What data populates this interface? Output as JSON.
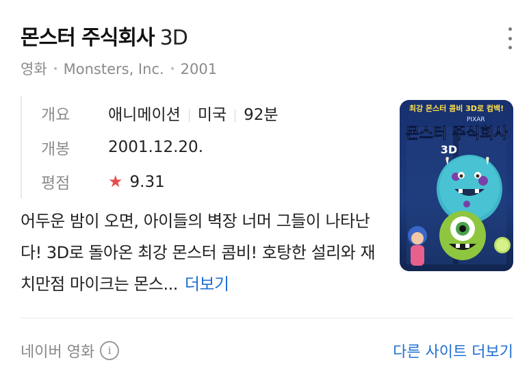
{
  "header": {
    "title": "몬스터 주식회사",
    "title_suffix": "3D",
    "more_icon": "more-vertical-icon"
  },
  "subtitle": {
    "category": "영화",
    "original_title": "Monsters, Inc.",
    "year": "2001"
  },
  "info": {
    "overview_label": "개요",
    "genre": "애니메이션",
    "country": "미국",
    "runtime": "92분",
    "release_label": "개봉",
    "release_date": "2001.12.20.",
    "rating_label": "평점",
    "rating_star": "★",
    "rating": "9.31",
    "star_color": "#e74c4c"
  },
  "poster": {
    "tagline": "최강 몬스터 콤비 3D로 컴백!",
    "brand": "PIXAR",
    "title": "몬스터 주식회사",
    "format": "3D"
  },
  "description": {
    "text": "어두운 밤이 오면, 아이들의 벽장 너머 그들이 나타난다! 3D로 돌아온 최강 몬스터 콤비! 호탕한 설리와 재치만점 마이크는 몬스...",
    "more_label": "더보기",
    "link_color": "#1f6fd1"
  },
  "footer": {
    "source": "네이버 영화",
    "info_icon": "info-circle-icon",
    "other_sites": "다른 사이트 더보기"
  }
}
